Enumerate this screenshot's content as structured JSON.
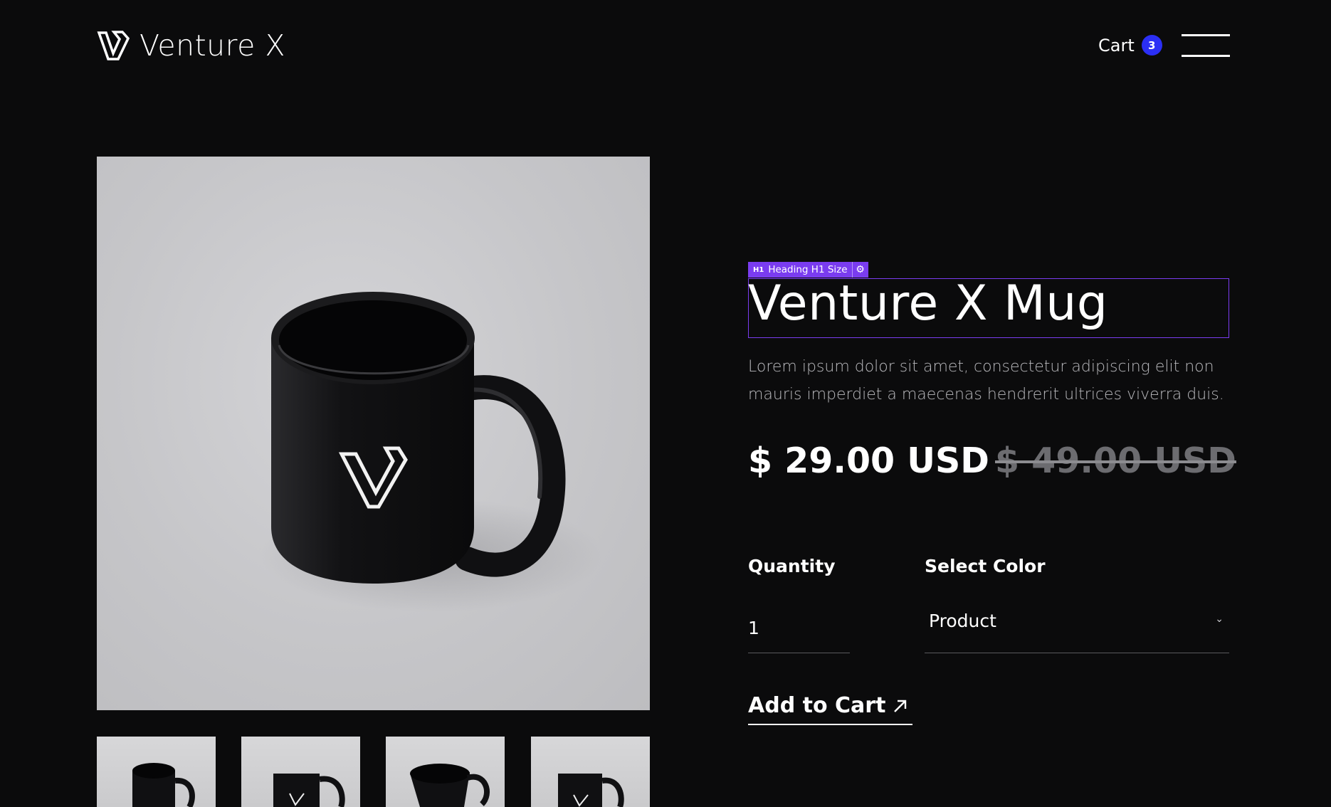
{
  "header": {
    "brand_name": "Venture X",
    "cart_label": "Cart",
    "cart_count": "3"
  },
  "product": {
    "editor_tag_prefix": "H1",
    "editor_tag_label": "Heading H1 Size",
    "title": "Venture X Mug",
    "description": "Lorem ipsum dolor sit amet, consectetur adipiscing elit non mauris imperdiet a maecenas hendrerit ultrices viverra duis.",
    "price": "$ 29.00 USD",
    "old_price": "$ 49.00 USD",
    "quantity_label": "Quantity",
    "quantity_value": "1",
    "color_label": "Select Color",
    "color_value": "Product",
    "add_to_cart_label": "Add to Cart"
  },
  "colors": {
    "background": "#0b0b0c",
    "accent_badge": "#2b2ff5",
    "editor_highlight": "#7a3cf0"
  },
  "icons": {
    "logo": "venture-x-logo-icon",
    "menu": "hamburger-menu-icon",
    "dropdown": "chevron-down-icon",
    "add_to_cart": "arrow-up-right-icon",
    "settings": "gear-icon"
  }
}
